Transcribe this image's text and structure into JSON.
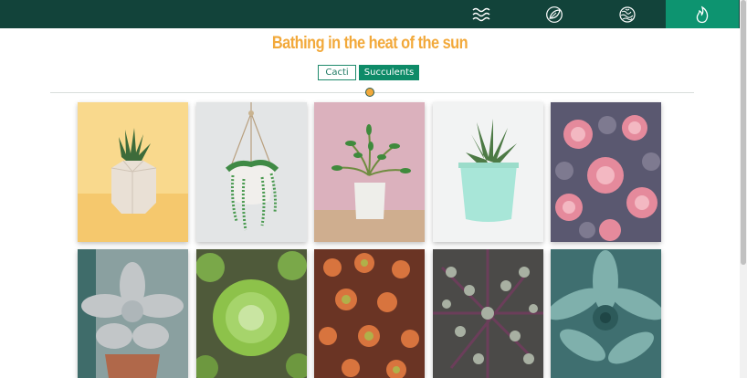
{
  "nav": {
    "items": [
      {
        "name": "waves",
        "icon": "waves-icon",
        "active": false
      },
      {
        "name": "leaf",
        "icon": "leaf-icon",
        "active": false
      },
      {
        "name": "brain-coral",
        "icon": "coral-icon",
        "active": false
      },
      {
        "name": "flame",
        "icon": "flame-icon",
        "active": true
      }
    ],
    "colors": {
      "bar": "#12433a",
      "active": "#0d9470",
      "icon": "#ffffff"
    }
  },
  "headline": "Bathing in the heat of the sun",
  "filters": [
    {
      "label": "Cacti",
      "selected": false
    },
    {
      "label": "Succulents",
      "selected": true
    }
  ],
  "colors": {
    "accent": "#f2a93b",
    "primary": "#0e8b68"
  },
  "gallery": {
    "rows": [
      [
        "potted-aloe-yellow-background",
        "hanging-string-of-pearls",
        "jade-plant-pink-wall",
        "haworthia-mint-pot",
        "pink-echeveria-cluster"
      ],
      [
        "grey-echeveria-rosette",
        "green-sempervivum-rosettes",
        "red-green-sedum-closeup",
        "grey-purple-stem-succulents",
        "blue-agave-closeup"
      ]
    ]
  }
}
